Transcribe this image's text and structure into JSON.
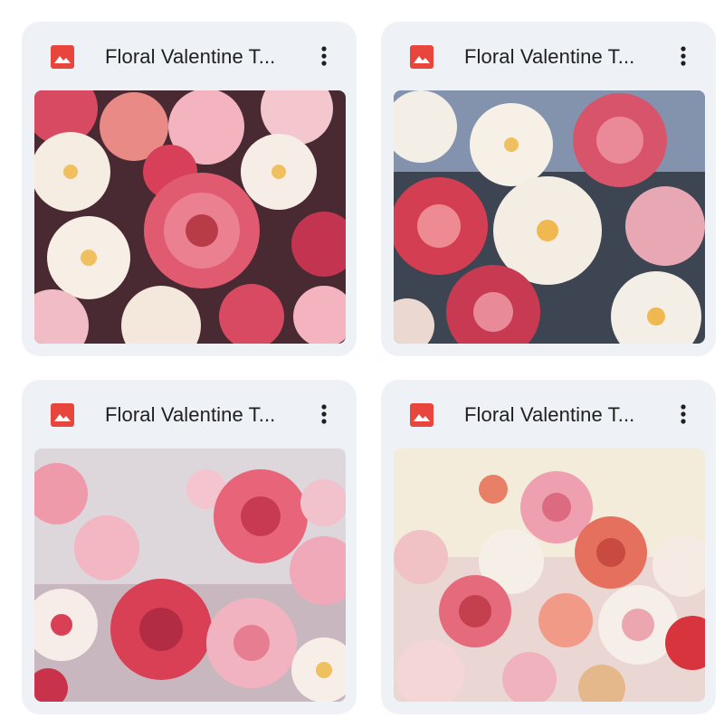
{
  "files": [
    {
      "title": "Floral Valentine T...",
      "type_icon": "image-icon",
      "menu_icon": "more-vert-icon",
      "palette": {
        "bg": "#4a2a32",
        "accent": "#d94f64",
        "light": "#f6ece4",
        "pink": "#f2b7c2"
      }
    },
    {
      "title": "Floral Valentine T...",
      "type_icon": "image-icon",
      "menu_icon": "more-vert-icon",
      "palette": {
        "bg": "#7a8aa6",
        "accent": "#d8546a",
        "light": "#f4efe6",
        "pink": "#eab0bb"
      }
    },
    {
      "title": "Floral Valentine T...",
      "type_icon": "image-icon",
      "menu_icon": "more-vert-icon",
      "palette": {
        "bg": "#d9d3d6",
        "accent": "#d94d63",
        "light": "#f8efee",
        "pink": "#f0a9b8"
      }
    },
    {
      "title": "Floral Valentine T...",
      "type_icon": "image-icon",
      "menu_icon": "more-vert-icon",
      "palette": {
        "bg": "#f3ead6",
        "accent": "#e0606a",
        "light": "#faf1ea",
        "pink": "#efb0ba"
      }
    }
  ],
  "colors": {
    "card_bg": "#eef1f6",
    "icon_red": "#e8453c",
    "title_text": "#1f1f1f"
  }
}
